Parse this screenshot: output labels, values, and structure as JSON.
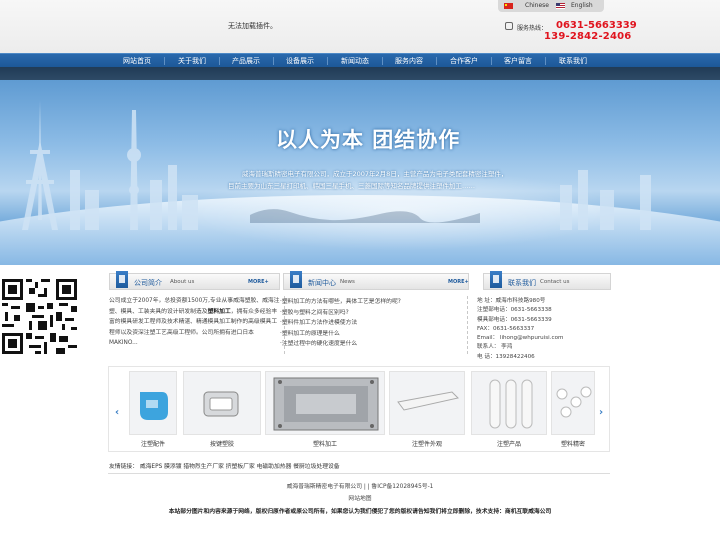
{
  "header": {
    "plugin_message": "无法加载插件。",
    "lang_cn": "Chinese",
    "lang_en": "English",
    "hotline_label": "服务热线：",
    "hotline_1": "0631-5663339",
    "hotline_2": "139-2842-2406"
  },
  "nav": [
    "网站首页",
    "关于我们",
    "产品展示",
    "设备展示",
    "新闻动态",
    "服务内容",
    "合作客户",
    "客户留言",
    "联系我们"
  ],
  "banner": {
    "slogan": "以人为本 团结协作",
    "line1": "威海普瑞斯精密电子有限公司，成立于2007年2月8日，主营产品为电子类配套精密注塑件，",
    "line2": "目前主要为山东三星打印机、韩国三星手机、三菱国际等知名品牌提供注塑件加工……"
  },
  "about": {
    "title": "公司简介",
    "subtitle": "About us",
    "more": "MORE+",
    "text_before": "公司成立于2007年，总投资额1500万,专业从事威海塑胶、威海注塑、模具、工装夹具的设计研发制造及",
    "text_bold": "塑料加工",
    "text_after": "，拥有众多经验丰富的模具研发工程师及技术精湛、精通模具加工制作的高级模具工程师以及资深注塑工艺高级工程师。公司所拥有进口日本MAKINO..."
  },
  "news": {
    "title": "新闻中心",
    "subtitle": "News",
    "more": "MORE+",
    "items": [
      "·塑料加工的方法有哪些，具体工艺是怎样的呢?",
      "·塑胶与塑料之间有区别吗?",
      "·塑料件加工方法作进模使方法",
      "·塑料加工的原理是什么",
      "·注塑过程中的硬化速度是什么"
    ]
  },
  "contact": {
    "title": "联系我们",
    "subtitle": "Contact us",
    "lines": [
      "地  址：威海市科技路980号",
      "注塑部电话：0631-5663338",
      "模具部电话：0631-5663339",
      "FAX：0631-5663337",
      "Email：  lihong@whpuruisi.com",
      "联系人：  李鸿",
      "电  话：13928422406"
    ]
  },
  "products": {
    "prev": "‹",
    "next": "›",
    "items": [
      {
        "label": "注塑配件"
      },
      {
        "label": "按键塑胶"
      },
      {
        "label": "塑料加工"
      },
      {
        "label": "注塑件外观"
      },
      {
        "label": "注塑产品"
      },
      {
        "label": "塑料精密"
      }
    ]
  },
  "links": "友情链接： 威海EPS 膜添镀 猎物烈生产厂家 挤塑板厂家 电磁助加热器 餐厨垃圾处理设备",
  "footer": {
    "line1": "威海普瑞斯精密电子有限公司 | | 鲁ICP备12028945号-1",
    "line2": "网站地图",
    "line3": "本站部分图片和内容来源于网络，版权归原作者或原公司所有，如果您认为我们侵犯了您的版权请告知我们将立即删除，技术支持：商机互联威海公司"
  },
  "colors": {
    "nav_blue": "#2365a8",
    "hotline_red": "#e0141e",
    "accent_blue": "#1e5a9c"
  }
}
